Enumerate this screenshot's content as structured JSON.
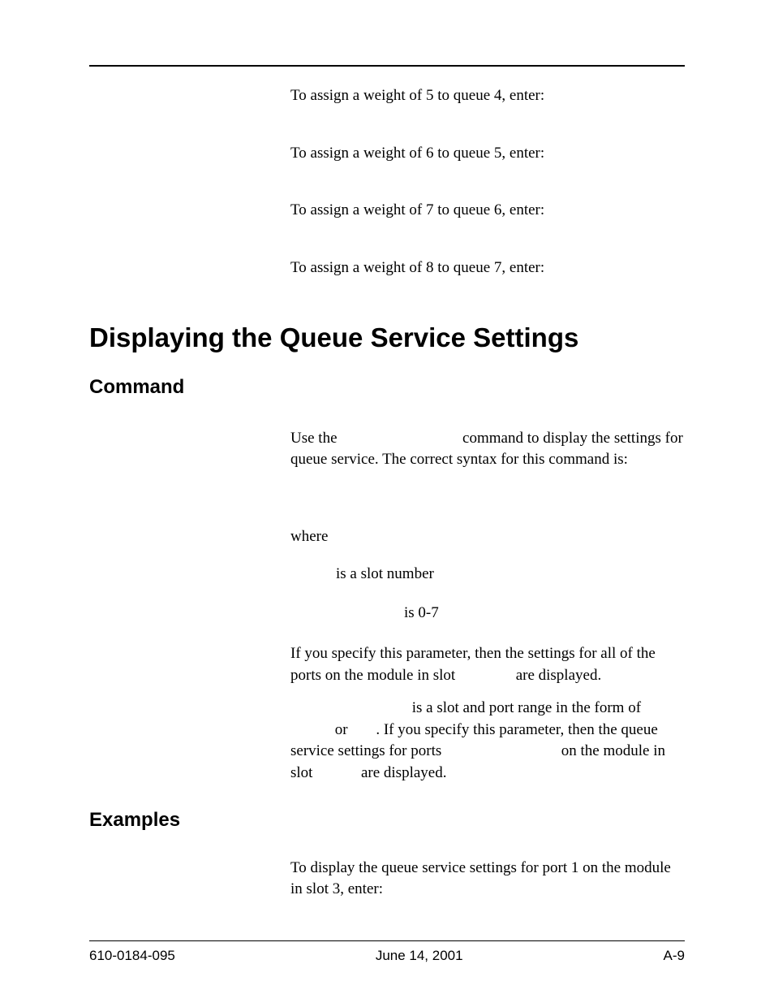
{
  "intro": {
    "p1": "To assign a weight of 5 to queue 4, enter:",
    "p2": "To assign a weight of 6 to queue 5, enter:",
    "p3": "To assign a weight of 7 to queue 6, enter:",
    "p4": "To assign a weight of 8 to queue 7, enter:"
  },
  "section": {
    "title": "Displaying the Queue Service Settings",
    "command_label": "Command",
    "command_para_a": "Use the ",
    "command_para_b": " command to display the settings for queue service. The correct syntax for this command is:",
    "where": "where",
    "slot_item": " is a slot number",
    "range_item": " is 0-7",
    "specify_a": "If you specify this parameter, then the settings for all of the ports on the module in slot ",
    "specify_b": " are displayed.",
    "portrange_a": " is a slot and port range in the form of ",
    "portrange_b": " or ",
    "portrange_c": ". If you specify this parameter, then the queue service settings for ports ",
    "portrange_d": " on the module in slot ",
    "portrange_e": " are displayed.",
    "examples_label": "Examples",
    "examples_para": "To display the queue service settings for port 1 on the module in slot 3, enter:"
  },
  "footer": {
    "left": "610-0184-095",
    "center": "June 14, 2001",
    "right": "A-9"
  }
}
